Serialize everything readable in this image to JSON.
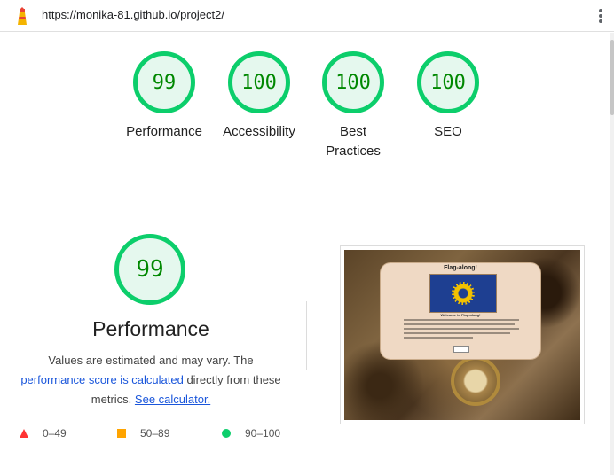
{
  "browser": {
    "url": "https://monika-81.github.io/project2/"
  },
  "summary_gauges": [
    {
      "score": "99",
      "label": "Performance"
    },
    {
      "score": "100",
      "label": "Accessibility"
    },
    {
      "score": "100",
      "label": "Best Practices"
    },
    {
      "score": "100",
      "label": "SEO"
    }
  ],
  "performance": {
    "score": "99",
    "title": "Performance",
    "desc_part1": "Values are estimated and may vary. The",
    "desc_link1": "performance score is calculated",
    "desc_part2": " directly from these metrics. ",
    "desc_link2": "See calculator."
  },
  "legend": [
    {
      "range": "0–49",
      "color": "#ff3333",
      "shape": "triangle"
    },
    {
      "range": "50–89",
      "color": "#ffa400",
      "shape": "square"
    },
    {
      "range": "90–100",
      "color": "#0cce6b",
      "shape": "circle"
    }
  ],
  "screenshot_thumb": {
    "heading": "Flag-along!",
    "welcome": "Welcome to Flag-along!"
  },
  "colors": {
    "pass_green": "#0cce6b",
    "score_text": "#008800",
    "link": "#1a56db"
  }
}
